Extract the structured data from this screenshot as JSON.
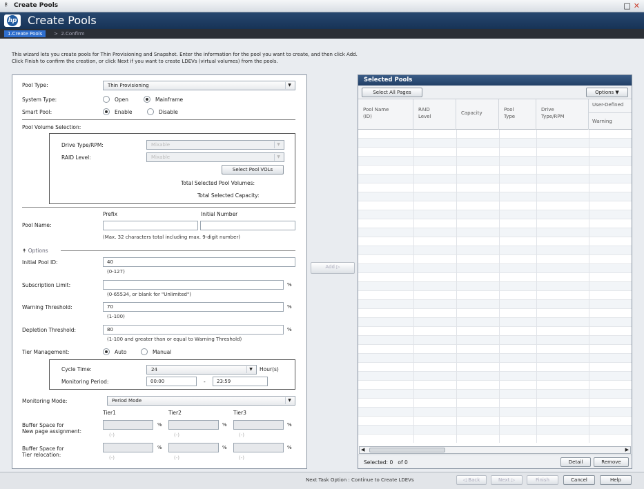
{
  "window": {
    "title": "Create Pools"
  },
  "header": {
    "title": "Create Pools"
  },
  "steps": {
    "step1": "1.Create Pools",
    "separator": ">",
    "step2": "2.Confirm"
  },
  "intro": {
    "line1": "This wizard lets you create pools for Thin Provisioning and Snapshot. Enter the information for the pool you want to create, and then click Add.",
    "line2": "Click Finish to confirm the creation, or click Next if you want to create LDEVs (virtual volumes) from the pools."
  },
  "form": {
    "pool_type": {
      "label": "Pool Type:",
      "value": "Thin Provisioning"
    },
    "system_type": {
      "label": "System Type:",
      "open": "Open",
      "mainframe": "Mainframe",
      "selected": "mainframe"
    },
    "smart_pool": {
      "label": "Smart Pool:",
      "enable": "Enable",
      "disable": "Disable",
      "selected": "enable"
    },
    "pool_volume_selection": {
      "label": "Pool Volume Selection:",
      "drive_type_label": "Drive Type/RPM:",
      "drive_type_value": "Mixable",
      "raid_level_label": "RAID Level:",
      "raid_level_value": "Mixable",
      "select_button": "Select Pool VOLs",
      "total_volumes_label": "Total Selected Pool Volumes:",
      "total_capacity_label": "Total Selected Capacity:"
    },
    "pool_name": {
      "label": "Pool Name:",
      "prefix_header": "Prefix",
      "initial_number_header": "Initial Number",
      "prefix_value": "",
      "initial_number_value": "",
      "hint": "(Max. 32 characters total including max. 9-digit number)"
    },
    "options_label": "Options",
    "initial_pool_id": {
      "label": "Initial Pool ID:",
      "value": "40",
      "hint": "(0-127)"
    },
    "subscription_limit": {
      "label": "Subscription Limit:",
      "value": "",
      "unit": "%",
      "hint": "(0-65534, or blank for \"Unlimited\")"
    },
    "warning_threshold": {
      "label": "Warning Threshold:",
      "value": "70",
      "unit": "%",
      "hint": "(1-100)"
    },
    "depletion_threshold": {
      "label": "Depletion Threshold:",
      "value": "80",
      "unit": "%",
      "hint": "(1-100 and greater than or equal to Warning Threshold)"
    },
    "tier_management": {
      "label": "Tier Management:",
      "auto": "Auto",
      "manual": "Manual",
      "selected": "auto"
    },
    "cycle_time": {
      "label": "Cycle Time:",
      "value": "24",
      "unit": "Hour(s)"
    },
    "monitoring_period": {
      "label": "Monitoring Period:",
      "start": "00:00",
      "dash": "-",
      "end": "23:59"
    },
    "monitoring_mode": {
      "label": "Monitoring Mode:",
      "value": "Period Mode"
    },
    "tiers": {
      "tier1": "Tier1",
      "tier2": "Tier2",
      "tier3": "Tier3"
    },
    "buffer_new": {
      "label_line1": "Buffer Space for",
      "label_line2": "New page assignment:",
      "unit": "%",
      "hint": "(-)"
    },
    "buffer_reloc": {
      "label_line1": "Buffer Space for",
      "label_line2": "Tier relocation:",
      "unit": "%",
      "hint": "(-)"
    }
  },
  "add_button": "Add ▷",
  "selected_pools": {
    "title": "Selected Pools",
    "select_all": "Select All Pages",
    "options": "Options",
    "columns": [
      {
        "line1": "Pool Name",
        "line2": "(ID)"
      },
      {
        "line1": "RAID",
        "line2": "Level"
      },
      {
        "line1": "Capacity",
        "line2": ""
      },
      {
        "line1": "Pool",
        "line2": "Type"
      },
      {
        "line1": "Drive",
        "line2": "Type/RPM"
      }
    ],
    "user_defined": "User-Defined",
    "warning": "Warning",
    "footer": {
      "selected_label": "Selected:",
      "selected_count": "0",
      "of_label": "of",
      "total": "0"
    },
    "detail": "Detail",
    "remove": "Remove"
  },
  "bottom": {
    "next_task_option": "Next Task Option : Continue to Create LDEVs",
    "back": "◁ Back",
    "next": "Next ▷",
    "finish": "Finish",
    "cancel": "Cancel",
    "help": "Help"
  }
}
